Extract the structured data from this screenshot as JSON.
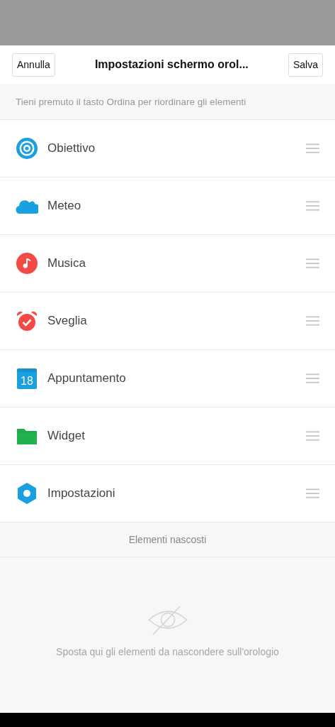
{
  "header": {
    "cancel": "Annulla",
    "title": "Impostazioni schermo orol...",
    "save": "Salva"
  },
  "hint": "Tieni premuto il tasto Ordina per riordinare gli elementi",
  "items": [
    {
      "kind": "target",
      "label": "Obiettivo"
    },
    {
      "kind": "weather",
      "label": "Meteo"
    },
    {
      "kind": "music",
      "label": "Musica"
    },
    {
      "kind": "alarm",
      "label": "Sveglia"
    },
    {
      "kind": "calendar",
      "label": "Appuntamento",
      "icon_text": "18"
    },
    {
      "kind": "folder",
      "label": "Widget"
    },
    {
      "kind": "settings",
      "label": "Impostazioni"
    }
  ],
  "hidden_section": {
    "title": "Elementi nascosti",
    "empty_text": "Sposta qui gli elementi da nascondere sull'orologio"
  }
}
